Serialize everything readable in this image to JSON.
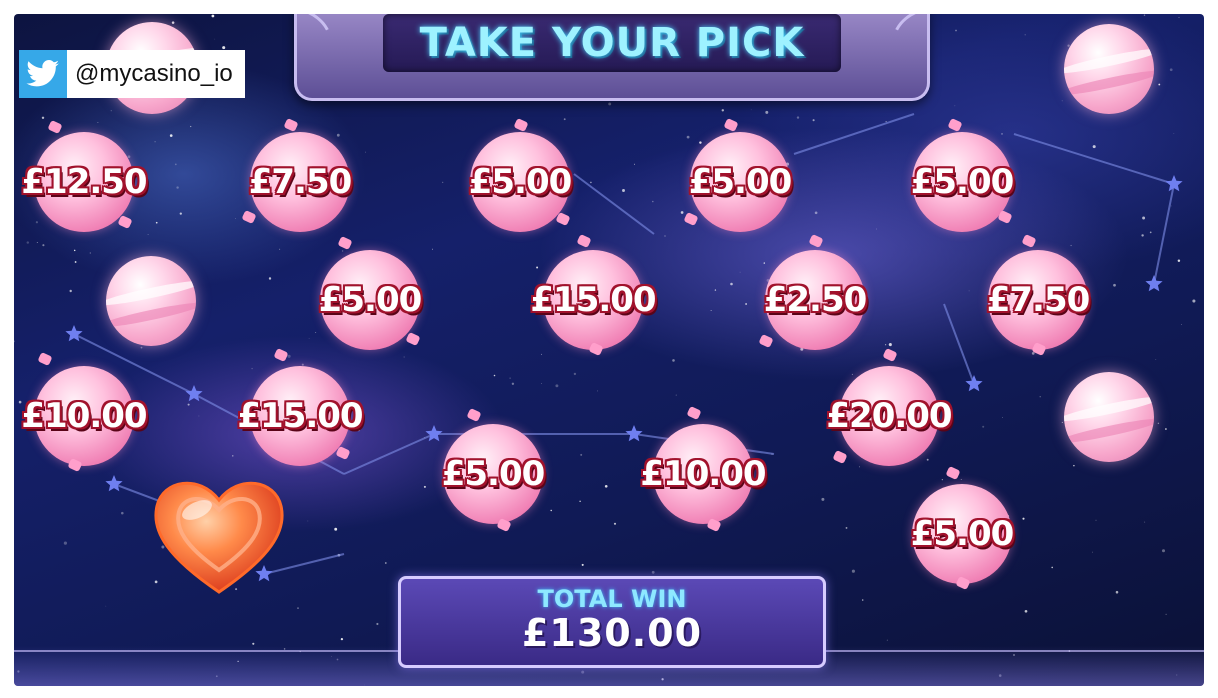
{
  "header": {
    "title": "TAKE YOUR PICK"
  },
  "watermark": {
    "icon": "twitter-bird-icon",
    "handle": "@mycasino_io"
  },
  "prizes": [
    {
      "value": "£12.50"
    },
    {
      "value": "£7.50"
    },
    {
      "value": "£5.00"
    },
    {
      "value": "£5.00"
    },
    {
      "value": "£5.00"
    },
    {
      "value": "£5.00"
    },
    {
      "value": "£15.00"
    },
    {
      "value": "£2.50"
    },
    {
      "value": "£7.50"
    },
    {
      "value": "£10.00"
    },
    {
      "value": "£15.00"
    },
    {
      "value": "£20.00"
    },
    {
      "value": "£5.00"
    },
    {
      "value": "£10.00"
    },
    {
      "value": "£5.00"
    }
  ],
  "total_win": {
    "label": "TOTAL WIN",
    "value": "£130.00"
  },
  "colors": {
    "title": "#9ef2ff",
    "prize_outline": "#a1122c",
    "total_label": "#8ee8ff",
    "background": "#15206a"
  }
}
